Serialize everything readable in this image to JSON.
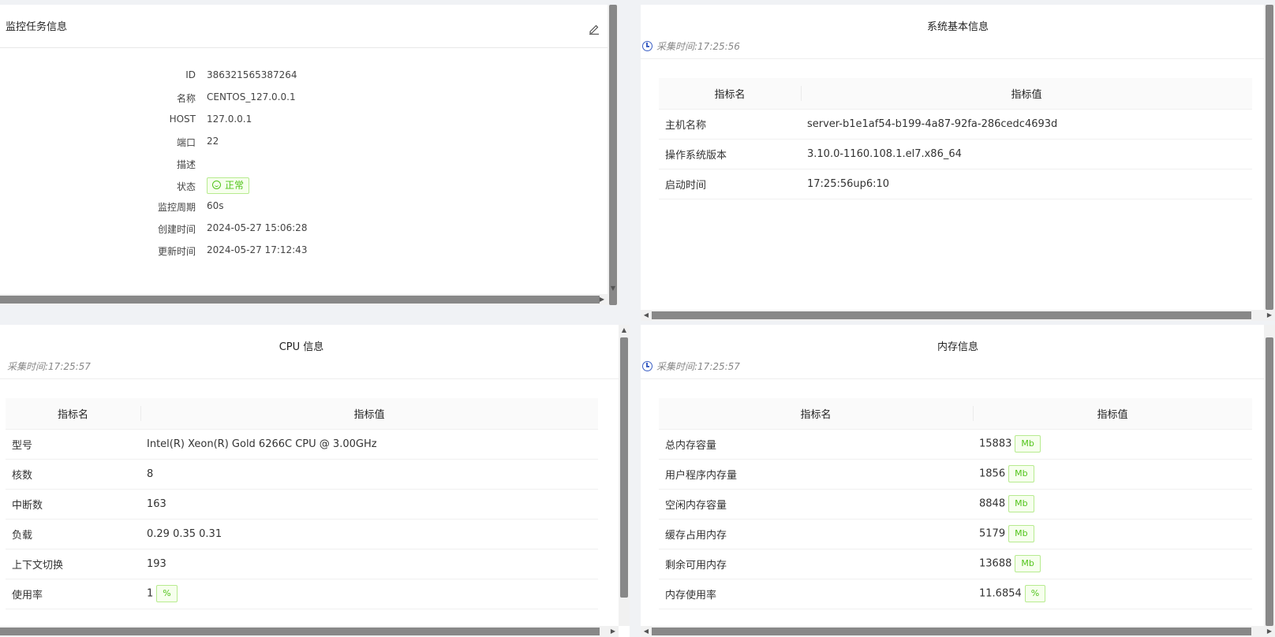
{
  "task_info": {
    "title": "监控任务信息",
    "fields": [
      {
        "label": "ID",
        "value": "386321565387264"
      },
      {
        "label": "名称",
        "value": "CENTOS_127.0.0.1"
      },
      {
        "label": "HOST",
        "value": "127.0.0.1"
      },
      {
        "label": "端口",
        "value": "22"
      },
      {
        "label": "描述",
        "value": ""
      },
      {
        "label": "状态",
        "value": "正常"
      },
      {
        "label": "监控周期",
        "value": "60s"
      },
      {
        "label": "创建时间",
        "value": "2024-05-27 15:06:28"
      },
      {
        "label": "更新时间",
        "value": "2024-05-27 17:12:43"
      }
    ]
  },
  "system_info": {
    "title": "系统基本信息",
    "collect_time": "采集时间:17:25:56",
    "headers": [
      "指标名",
      "指标值"
    ],
    "rows": [
      {
        "name": "主机名称",
        "value": "server-b1e1af54-b199-4a87-92fa-286cedc4693d"
      },
      {
        "name": "操作系统版本",
        "value": "3.10.0-1160.108.1.el7.x86_64"
      },
      {
        "name": "启动时间",
        "value": "17:25:56up6:10"
      }
    ]
  },
  "cpu_info": {
    "title": "CPU 信息",
    "collect_time": "采集时间:17:25:57",
    "headers": [
      "指标名",
      "指标值"
    ],
    "rows": [
      {
        "name": "型号",
        "value": "Intel(R) Xeon(R) Gold 6266C CPU @ 3.00GHz",
        "unit": ""
      },
      {
        "name": "核数",
        "value": "8",
        "unit": ""
      },
      {
        "name": "中断数",
        "value": "163",
        "unit": ""
      },
      {
        "name": "负载",
        "value": "0.29 0.35 0.31",
        "unit": ""
      },
      {
        "name": "上下文切换",
        "value": "193",
        "unit": ""
      },
      {
        "name": "使用率",
        "value": "1",
        "unit": "%"
      }
    ]
  },
  "memory_info": {
    "title": "内存信息",
    "collect_time": "采集时间:17:25:57",
    "headers": [
      "指标名",
      "指标值"
    ],
    "rows": [
      {
        "name": "总内存容量",
        "value": "15883",
        "unit": "Mb"
      },
      {
        "name": "用户程序内存量",
        "value": "1856",
        "unit": "Mb"
      },
      {
        "name": "空闲内存容量",
        "value": "8848",
        "unit": "Mb"
      },
      {
        "name": "缓存占用内存",
        "value": "5179",
        "unit": "Mb"
      },
      {
        "name": "剩余可用内存",
        "value": "13688",
        "unit": "Mb"
      },
      {
        "name": "内存使用率",
        "value": "11.6854",
        "unit": "%"
      }
    ]
  },
  "colors": {
    "accent": "#3b5fc4",
    "success": "#52c41a"
  },
  "icons": {
    "edit": "edit-icon",
    "clock": "clock-icon",
    "status": "smile-icon"
  }
}
